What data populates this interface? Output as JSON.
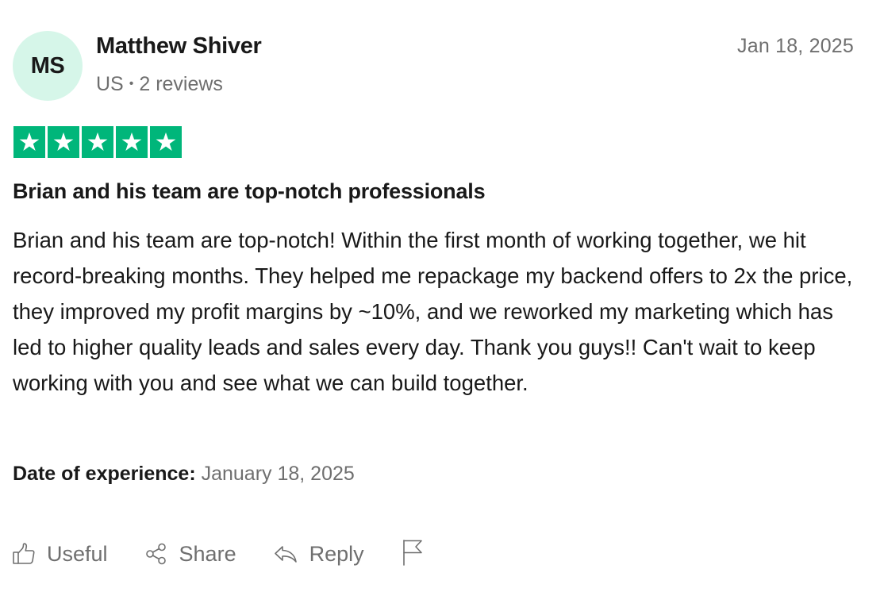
{
  "reviewer": {
    "initials": "MS",
    "name": "Matthew Shiver",
    "country": "US",
    "separator": "•",
    "review_count": "2 reviews"
  },
  "review": {
    "date": "Jan 18, 2025",
    "rating": 5,
    "rating_max": 5,
    "title": "Brian and his team are top-notch professionals",
    "body": "Brian and his team are top-notch! Within the first month of working together, we hit record-breaking months. They helped me repackage my backend offers to 2x the price, they improved my profit margins by ~10%, and we reworked my marketing which has led to higher quality leads and sales every day. Thank you guys!! Can't wait to keep working with you and see what we can build together.",
    "experience_label": "Date of experience:",
    "experience_date": "January 18, 2025"
  },
  "actions": {
    "useful_label": "Useful",
    "share_label": "Share",
    "reply_label": "Reply",
    "useful_icon": "thumbs-up-icon",
    "share_icon": "share-icon",
    "reply_icon": "reply-icon",
    "flag_icon": "flag-icon"
  },
  "colors": {
    "star_green": "#00b67a",
    "avatar_bg": "#d6f6e9",
    "muted_text": "#6f6f6f",
    "primary_text": "#191919"
  }
}
